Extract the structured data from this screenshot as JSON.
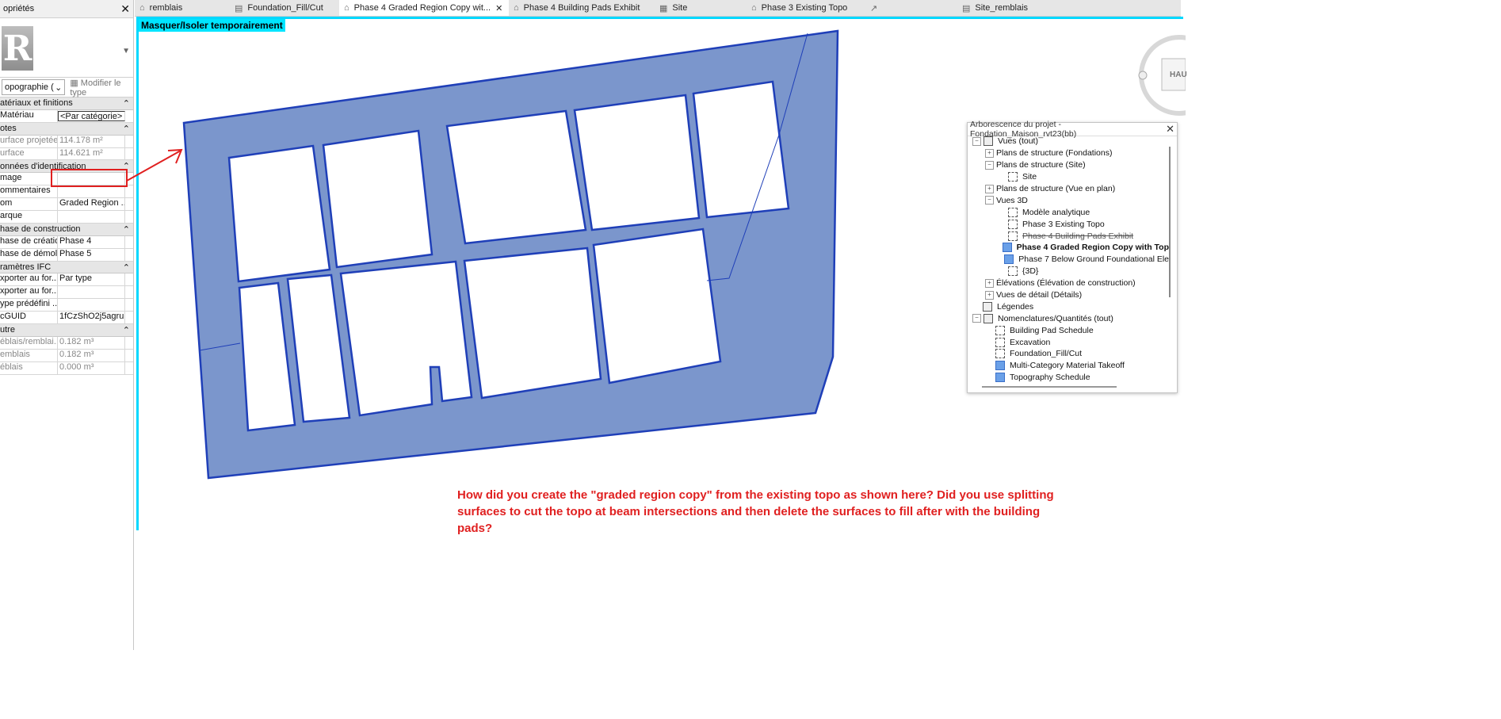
{
  "properties": {
    "title": "opriétés",
    "type_selector": "opographie (",
    "edit_type": "Modifier le type",
    "sections": [
      {
        "name": "atériaux et finitions",
        "rows": [
          {
            "k": "Matériau",
            "v": "<Par catégorie>",
            "boxed": true
          }
        ]
      },
      {
        "name": "otes",
        "rows": [
          {
            "k": "urface projetée",
            "v": "114.178 m²",
            "grey": true
          },
          {
            "k": "urface",
            "v": "114.621 m²",
            "grey": true
          }
        ]
      },
      {
        "name": "onnées d'identification",
        "rows": [
          {
            "k": "mage",
            "v": ""
          },
          {
            "k": "ommentaires",
            "v": ""
          },
          {
            "k": "om",
            "v": "Graded Region ..."
          },
          {
            "k": "arque",
            "v": ""
          }
        ]
      },
      {
        "name": "hase de construction",
        "rows": [
          {
            "k": "hase de création",
            "v": "Phase 4"
          },
          {
            "k": "hase de démol...",
            "v": "Phase 5"
          }
        ]
      },
      {
        "name": "ramètres IFC",
        "rows": [
          {
            "k": "xporter au for...",
            "v": "Par type"
          },
          {
            "k": "xporter au for...",
            "v": ""
          },
          {
            "k": "ype prédéfini ...",
            "v": ""
          },
          {
            "k": "cGUID",
            "v": "1fCzShO2j5agru..."
          }
        ]
      },
      {
        "name": "utre",
        "rows": [
          {
            "k": "éblais/remblai...",
            "v": "0.182 m³",
            "grey": true
          },
          {
            "k": "emblais",
            "v": "0.182 m³",
            "grey": true
          },
          {
            "k": "éblais",
            "v": "0.000 m³",
            "grey": true
          }
        ]
      }
    ]
  },
  "tabs": [
    {
      "label": "remblais",
      "icon": "⌂"
    },
    {
      "label": "Foundation_Fill/Cut",
      "icon": "▤"
    },
    {
      "label": "Phase 4 Graded Region Copy wit...",
      "icon": "⌂",
      "active": true,
      "close": "✕"
    },
    {
      "label": "Phase 4 Building Pads Exhibit",
      "icon": "⌂"
    },
    {
      "label": "Site",
      "icon": "▦"
    },
    {
      "label": "Phase 3 Existing Topo",
      "icon": "⌂"
    },
    {
      "label": "",
      "icon": "↗"
    },
    {
      "label": "Site_remblais",
      "icon": "▤"
    }
  ],
  "view": {
    "isolate_label": "Masquer/Isoler temporairement",
    "question": "How did you create the \"graded region copy\" from the existing topo as shown here? Did you use splitting surfaces to cut the topo at beam intersections and then delete the surfaces to fill after with the building pads?",
    "navcube_label": "HAU",
    "region_fill": "#7b96cc",
    "region_stroke": "#1f3fb8",
    "annotation_color": "#e02020"
  },
  "browser": {
    "title": "Arborescence du projet - Fondation_Maison_rvt23(bb)",
    "close": "✕",
    "nodes": [
      {
        "label": "Vues (tout)",
        "indent": 0,
        "exp": "−",
        "icon": "views"
      },
      {
        "label": "Plans de structure (Fondations)",
        "indent": 1,
        "exp": "+"
      },
      {
        "label": "Plans de structure (Site)",
        "indent": 1,
        "exp": "−"
      },
      {
        "label": "Site",
        "indent": 2,
        "icon": "dash"
      },
      {
        "label": "Plans de structure (Vue en plan)",
        "indent": 1,
        "exp": "+"
      },
      {
        "label": "Vues 3D",
        "indent": 1,
        "exp": "−"
      },
      {
        "label": "Modèle analytique",
        "indent": 2,
        "icon": "dash"
      },
      {
        "label": "Phase 3 Existing Topo",
        "indent": 2,
        "icon": "dash"
      },
      {
        "label": "Phase 4 Building Pads Exhibit",
        "indent": 2,
        "icon": "dash",
        "strike": true
      },
      {
        "label": "Phase 4 Graded Region Copy with Top",
        "indent": 2,
        "icon": "blue",
        "selected": true
      },
      {
        "label": "Phase 7 Below Ground Foundational Ele",
        "indent": 2,
        "icon": "blue"
      },
      {
        "label": "{3D}",
        "indent": 2,
        "icon": "dash"
      },
      {
        "label": "Élévations (Élévation de construction)",
        "indent": 1,
        "exp": "+"
      },
      {
        "label": "Vues de détail (Détails)",
        "indent": 1,
        "exp": "+"
      },
      {
        "label": "Légendes",
        "indent": 0,
        "icon": "table"
      },
      {
        "label": "Nomenclatures/Quantités (tout)",
        "indent": 0,
        "exp": "−",
        "icon": "table"
      },
      {
        "label": "Building Pad Schedule",
        "indent": 1,
        "icon": "dash"
      },
      {
        "label": "Excavation",
        "indent": 1,
        "icon": "dash"
      },
      {
        "label": "Foundation_Fill/Cut",
        "indent": 1,
        "icon": "dash"
      },
      {
        "label": "Multi-Category Material Takeoff",
        "indent": 1,
        "icon": "blue"
      },
      {
        "label": "Topography Schedule",
        "indent": 1,
        "icon": "blue"
      }
    ]
  }
}
